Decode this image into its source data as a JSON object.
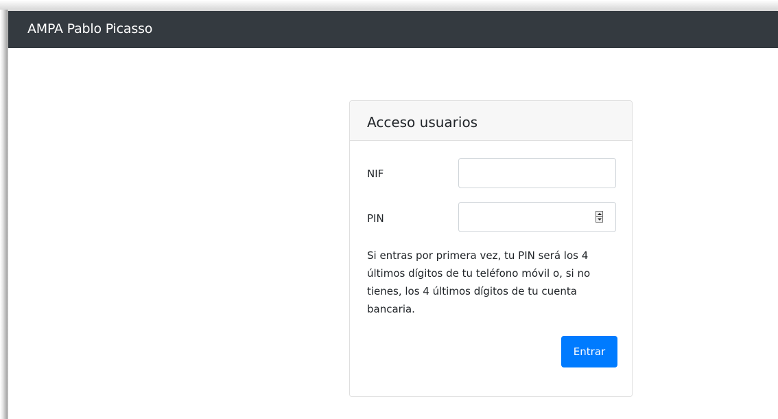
{
  "navbar": {
    "brand": "AMPA Pablo Picasso",
    "background": "#343a40"
  },
  "login_card": {
    "title": "Acceso usuarios",
    "nif": {
      "label": "NIF",
      "value": "",
      "placeholder": ""
    },
    "pin": {
      "label": "PIN",
      "value": "",
      "placeholder": "",
      "spinner_icon": "spin-up-down-icon"
    },
    "help_text": "Si entras por primera vez, tu PIN será los 4 últimos dígitos de tu teléfono móvil o, si no tienes, los 4 últimos dígitos de tu cuenta bancaria.",
    "submit_label": "Entrar",
    "accent": "#007bff"
  }
}
